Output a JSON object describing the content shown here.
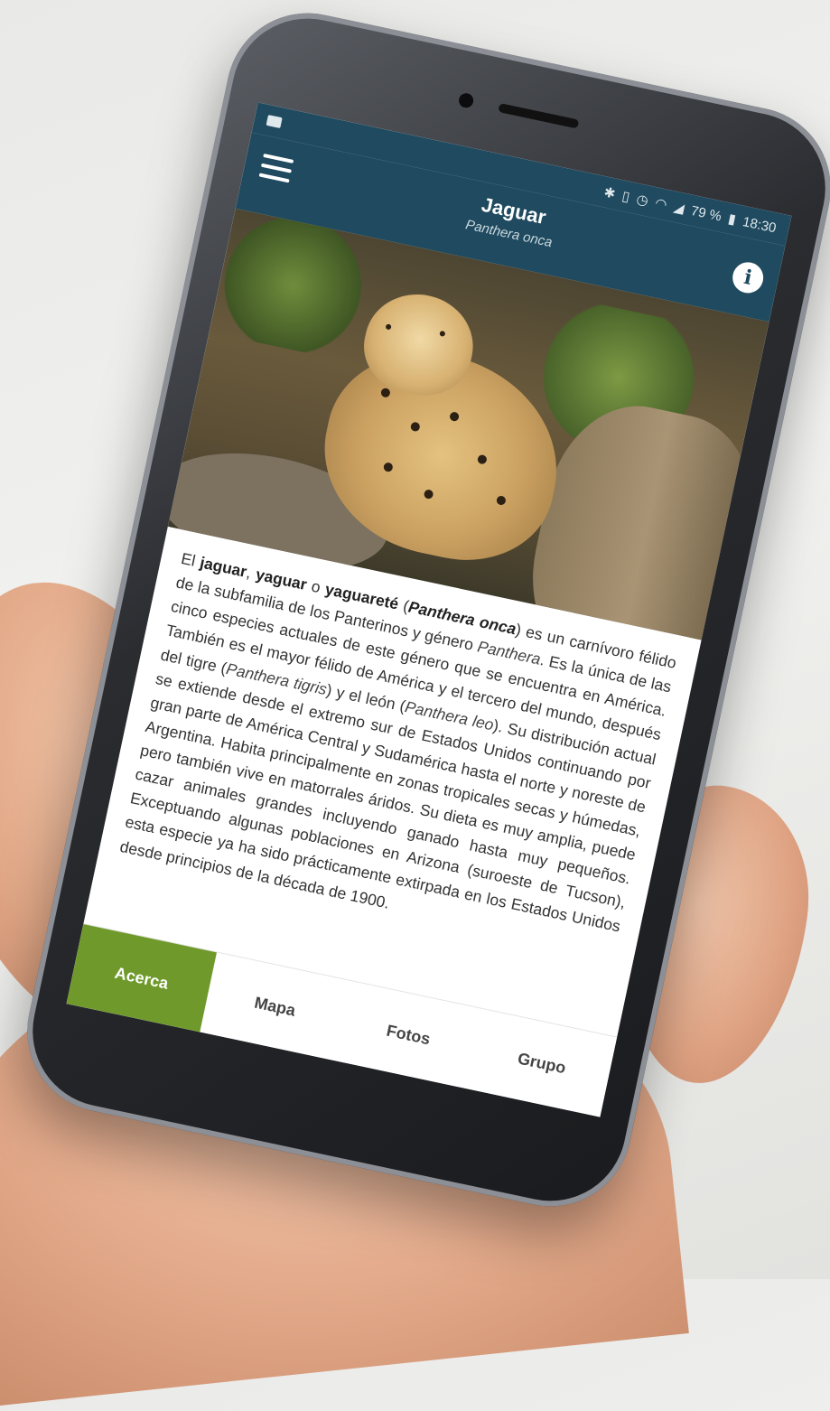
{
  "statusbar": {
    "battery": "79 %",
    "time": "18:30"
  },
  "appbar": {
    "title": "Jaguar",
    "subtitle": "Panthera onca"
  },
  "description": {
    "p1": "El ",
    "name1": "jaguar",
    "sep1": ", ",
    "name2": "yaguar",
    "sep2": " o ",
    "name3": "yaguareté",
    "sep3": " (",
    "sci": "Panthera onca",
    "rest1": ") es un carnívoro félido de la subfamilia de los Panterinos y género ",
    "genus": "Panthera",
    "rest2": ". Es la única de las cinco especies actuales de este género que se encuentra en América. También es el mayor félido de América y el tercero del mundo, después del tigre (",
    "tigris": "Panthera tigris",
    "rest3": ") y el león (",
    "leo": "Panthera leo",
    "rest4": "). Su distribución actual se extiende desde el extremo sur de Estados Unidos continuando por gran parte de América Central y Sudamérica hasta el norte y noreste de Argentina. Habita principalmente en zonas tropicales secas y húmedas, pero también vive en matorrales áridos. Su dieta es muy amplia, puede cazar animales grandes incluyendo ganado hasta muy pequeños. Exceptuando algunas poblaciones en Arizona (suroeste de Tucson), esta especie ya ha sido prácticamente extirpada en los Estados Unidos desde principios de la década de 1900."
  },
  "tabs": [
    {
      "label": "Acerca"
    },
    {
      "label": "Mapa"
    },
    {
      "label": "Fotos"
    },
    {
      "label": "Grupo"
    }
  ],
  "colors": {
    "appbar": "#1f4a5f",
    "active_tab": "#6f9a2b"
  }
}
